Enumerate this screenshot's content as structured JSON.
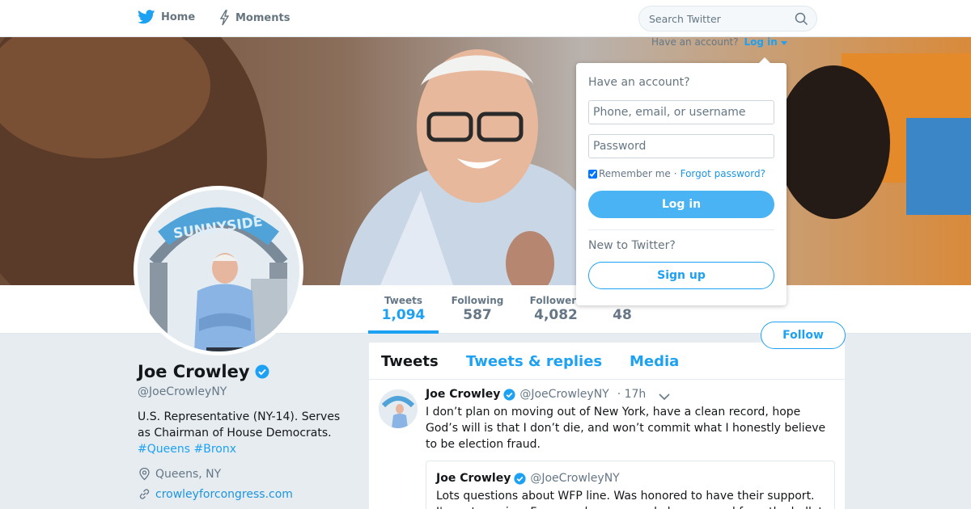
{
  "nav": {
    "home_label": "Home",
    "moments_label": "Moments",
    "search_placeholder": "Search Twitter"
  },
  "account_prompt": {
    "text": "Have an account?",
    "login_link": "Log in"
  },
  "login_dropdown": {
    "heading": "Have an account?",
    "username_placeholder": "Phone, email, or username",
    "password_placeholder": "Password",
    "remember_label": "Remember me",
    "separator": "·",
    "forgot_label": "Forgot password?",
    "login_button": "Log in",
    "new_heading": "New to Twitter?",
    "signup_button": "Sign up"
  },
  "profile": {
    "name": "Joe Crowley",
    "handle": "@JoeCrowleyNY",
    "bio": "U.S. Representative (NY-14). Serves as Chairman of House Democrats.",
    "hashtags": [
      "#Queens",
      "#Bronx"
    ],
    "location": "Queens, NY",
    "website": "crowleyforcongress.com",
    "verified": true
  },
  "stats": [
    {
      "label": "Tweets",
      "value": "1,094",
      "active": true
    },
    {
      "label": "Following",
      "value": "587",
      "active": false
    },
    {
      "label": "Followers",
      "value": "4,082",
      "active": false
    },
    {
      "label": "",
      "value": "48",
      "active": false
    }
  ],
  "follow_button": "Follow",
  "timeline": {
    "tabs": [
      {
        "label": "Tweets",
        "active": true
      },
      {
        "label": "Tweets & replies",
        "active": false
      },
      {
        "label": "Media",
        "active": false
      }
    ],
    "tweet": {
      "name": "Joe Crowley",
      "handle": "@JoeCrowleyNY",
      "time": "· 17h",
      "text": "I don’t plan on moving out of New York, have a clean record, hope God’s will is that I don’t die, and won’t commit what I honestly believe to be election fraud.",
      "quote": {
        "name": "Joe Crowley",
        "handle": "@JoeCrowleyNY",
        "text": "Lots questions about WFP line. Was honored to have their support. I'm not running. For record you can only be removed from the ballot"
      }
    }
  },
  "colors": {
    "accent": "#1da1f2",
    "background": "#e6ecf0",
    "text_secondary": "#657786"
  }
}
